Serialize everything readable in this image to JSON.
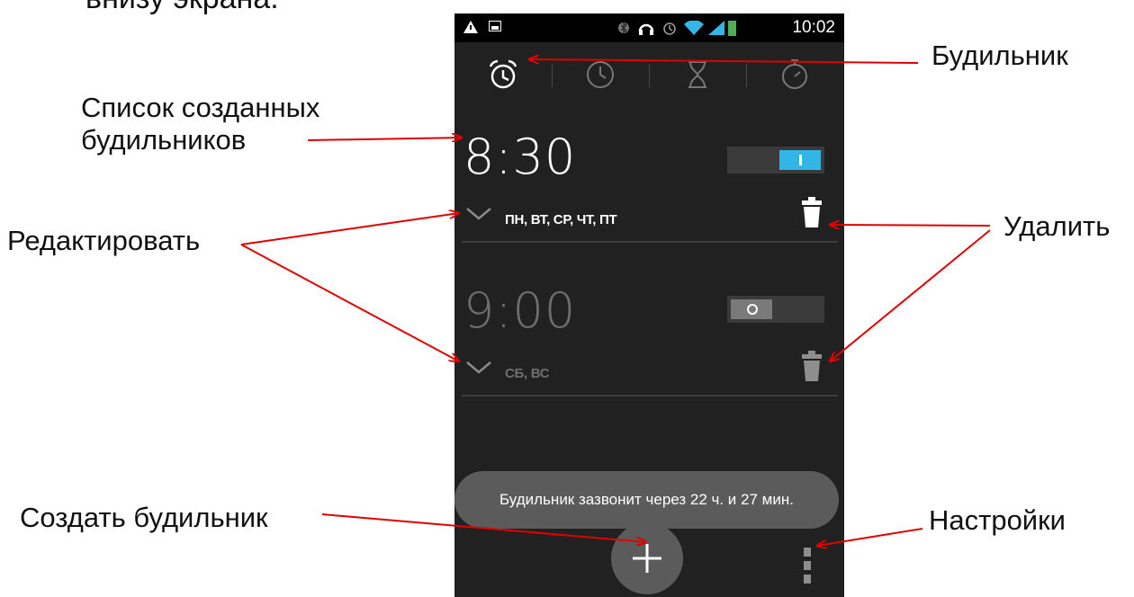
{
  "annotations": {
    "title_cut": "внизу экрана.",
    "alarm_list": "Список созданных\nбудильников",
    "alarm_list_line1": "Список созданных",
    "alarm_list_line2": "будильников",
    "edit": "Редактировать",
    "create": "Создать будильник",
    "alarm_tab": "Будильник",
    "delete": "Удалить",
    "settings": "Настройки"
  },
  "statusbar": {
    "time": "10:02"
  },
  "tabs": [
    {
      "icon": "alarm-clock-icon",
      "active": true
    },
    {
      "icon": "clock-icon",
      "active": false
    },
    {
      "icon": "hourglass-icon",
      "active": false
    },
    {
      "icon": "stopwatch-icon",
      "active": false
    }
  ],
  "alarms": [
    {
      "time": "8:30",
      "days": "ПН, ВТ, СР, ЧТ, ПТ",
      "enabled": true
    },
    {
      "time": "9:00",
      "days": "СБ, ВС",
      "enabled": false
    }
  ],
  "toast": "Будильник зазвонит через 22 ч. и 27 мин.",
  "colors": {
    "accent": "#33b5e5",
    "arrow": "#e00000",
    "screen_bg": "#212121"
  }
}
